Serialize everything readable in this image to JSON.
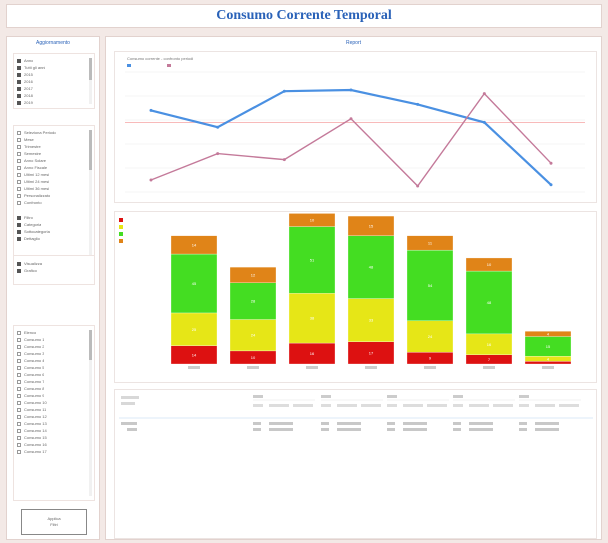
{
  "app": {
    "title": "Consumo Corrente Temporal"
  },
  "left_panel": {
    "title": "Aggiornamento",
    "list1": [
      "Anno",
      "Tutti gli anni",
      "2015",
      "2016",
      "2017",
      "2018",
      "2019"
    ],
    "list2": [
      "Seleziona Periodo",
      "Mese",
      "Trimestre",
      "Semestre",
      "Anno Solare",
      "Anno Fiscale",
      "Ultimi 12 mesi",
      "Ultimi 24 mesi",
      "Ultimi 36 mesi",
      "Personalizzato",
      "Confronto"
    ],
    "list2_sub": [
      "Filtro",
      "Categoria",
      "Sottocategoria",
      "Dettaglio"
    ],
    "list3": [
      "Visualizza",
      "Grafico"
    ],
    "list4": [
      "Elenco",
      "Consumo 1",
      "Consumo 2",
      "Consumo 3",
      "Consumo 4",
      "Consumo 5",
      "Consumo 6",
      "Consumo 7",
      "Consumo 8",
      "Consumo 9",
      "Consumo 10",
      "Consumo 11",
      "Consumo 12",
      "Consumo 13",
      "Consumo 14",
      "Consumo 15",
      "Consumo 16",
      "Consumo 17"
    ],
    "button_line1": "Applica",
    "button_line2": "Filtri"
  },
  "report": {
    "title": "Report"
  },
  "line_chart_caption": "Consumo corrente - confronto periodi",
  "chart_data": [
    {
      "type": "line",
      "x": [
        1,
        2,
        3,
        4,
        5,
        6,
        7
      ],
      "series": [
        {
          "values": [
            68,
            54,
            84,
            85,
            73,
            58,
            6
          ],
          "color": "#4a90e2"
        },
        {
          "values": [
            10,
            32,
            27,
            61,
            5,
            82,
            24
          ],
          "color": "#c47a9a"
        }
      ],
      "reference_line": {
        "value": 58,
        "color": "#f5a3a3"
      },
      "ylim": [
        0,
        100
      ],
      "grid": true
    },
    {
      "type": "bar",
      "stacked": true,
      "categories": [
        "",
        "",
        "",
        "",
        "",
        "",
        ""
      ],
      "series": [
        {
          "color": "#dd1111",
          "values": [
            14,
            10,
            16,
            17,
            9,
            7,
            2
          ]
        },
        {
          "color": "#e6e617",
          "values": [
            25,
            24,
            38,
            33,
            24,
            16,
            4
          ]
        },
        {
          "color": "#44dd22",
          "values": [
            45,
            28,
            51,
            48,
            54,
            48,
            15
          ]
        },
        {
          "color": "#e08418",
          "values": [
            14,
            12,
            10,
            15,
            11,
            10,
            4
          ]
        }
      ],
      "ylim": [
        0,
        110
      ],
      "legend": "top-left"
    }
  ],
  "grid_table": {
    "groups": [
      "",
      "",
      "",
      "",
      ""
    ]
  }
}
